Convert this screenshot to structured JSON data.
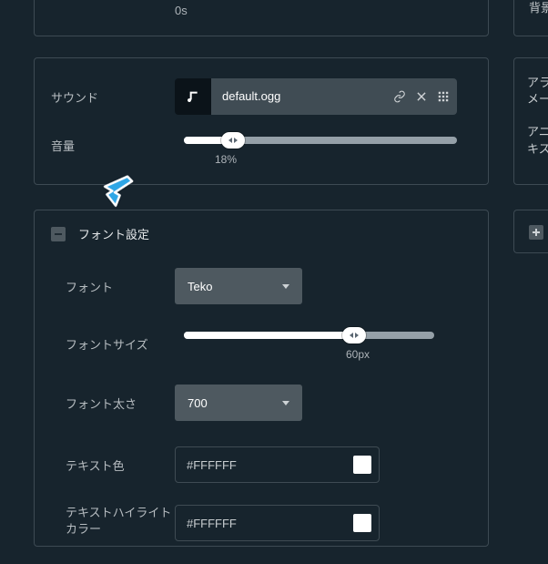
{
  "top_panel": {
    "value": "0s"
  },
  "sound_panel": {
    "label": "サウンド",
    "file_name": "default.ogg",
    "icons": {
      "music": "music-icon",
      "link": "link-icon",
      "close": "close-icon",
      "grid": "grid-icon"
    },
    "volume_label": "音量",
    "volume_pct": 18,
    "volume_text": "18%"
  },
  "font_panel": {
    "title": "フォント設定",
    "font_label": "フォント",
    "font_value": "Teko",
    "size_label": "フォントサイズ",
    "size_value": 60,
    "size_readout": "60px",
    "size_slider_pct": 68,
    "weight_label": "フォント太さ",
    "weight_value": "700",
    "text_color_label": "テキスト色",
    "text_color_value": "#FFFFFF",
    "highlight_label": "テキストハイライトカラー",
    "highlight_value": "#FFFFFF"
  },
  "right_strip": {
    "line1": "背景",
    "line2a": "アラ",
    "line2b": "メー",
    "line3a": "アニ",
    "line3b": "キス"
  },
  "colors": {
    "swatch_text": "#FFFFFF",
    "swatch_highlight": "#FFFFFF"
  }
}
